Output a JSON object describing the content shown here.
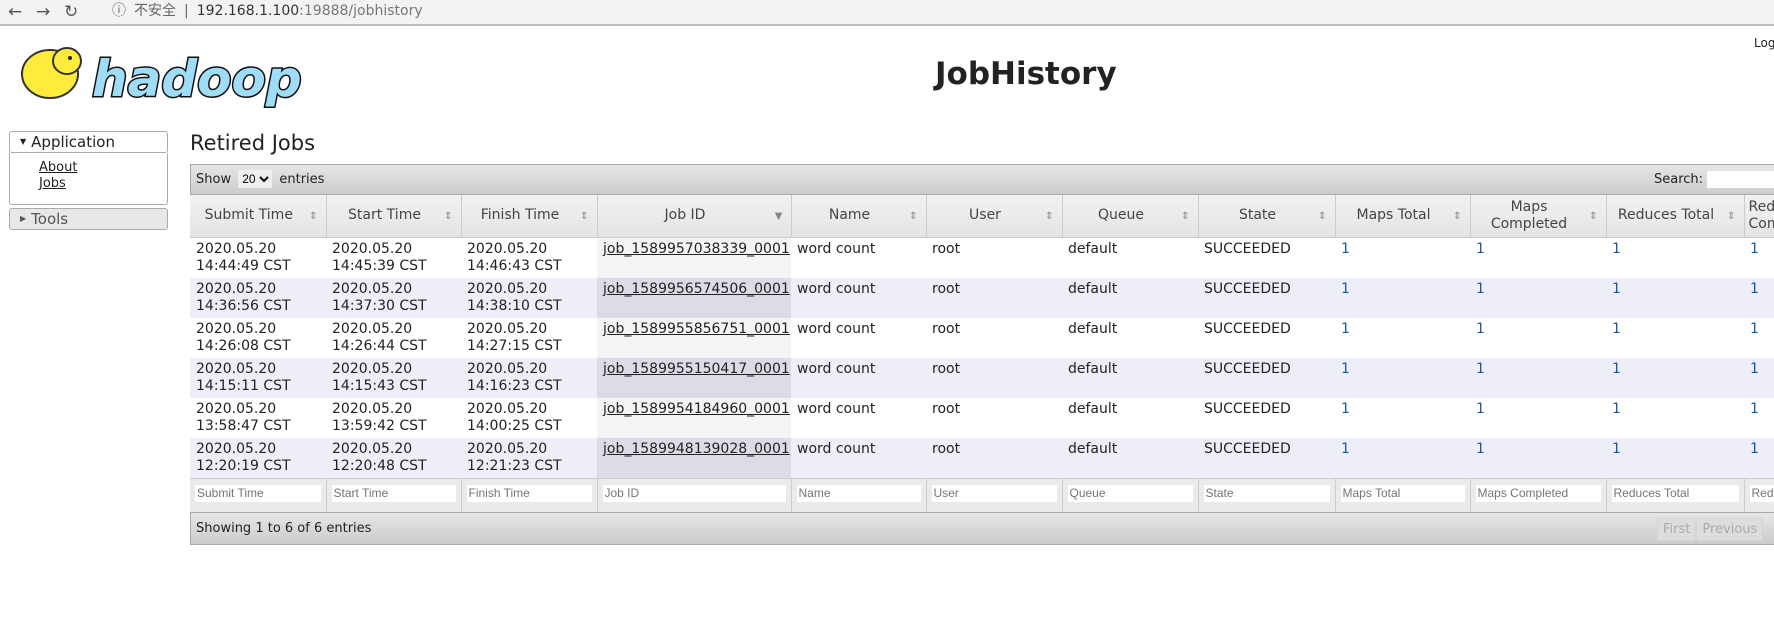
{
  "browser": {
    "url_host": "192.168.1.100",
    "url_rest": ":19888/jobhistory",
    "security_label": "不安全"
  },
  "header": {
    "logo_text": "hadoop",
    "title": "JobHistory",
    "login": "Log"
  },
  "sidebar": {
    "application": "Application",
    "links": [
      "About",
      "Jobs"
    ],
    "tools": "Tools"
  },
  "main": {
    "heading": "Retired Jobs",
    "show": "Show",
    "entries_value": "20",
    "entries": "entries",
    "search": "Search:",
    "columns": [
      "Submit Time",
      "Start Time",
      "Finish Time",
      "Job ID",
      "Name",
      "User",
      "Queue",
      "State",
      "Maps Total",
      "Maps Completed",
      "Reduces Total",
      "Reduces Completed"
    ],
    "filters": [
      "Submit Time",
      "Start Time",
      "Finish Time",
      "Job ID",
      "Name",
      "User",
      "Queue",
      "State",
      "Maps Total",
      "Maps Completed",
      "Reduces Total",
      "Reduces Completed"
    ],
    "rows": [
      {
        "submit": [
          "2020.05.20",
          "14:44:49 CST"
        ],
        "start": [
          "2020.05.20",
          "14:45:39 CST"
        ],
        "finish": [
          "2020.05.20",
          "14:46:43 CST"
        ],
        "job": "job_1589957038339_0001",
        "name": "word count",
        "user": "root",
        "queue": "default",
        "state": "SUCCEEDED",
        "maps_total": "1",
        "maps_completed": "1",
        "reduces_total": "1",
        "reduces_completed": "1"
      },
      {
        "submit": [
          "2020.05.20",
          "14:36:56 CST"
        ],
        "start": [
          "2020.05.20",
          "14:37:30 CST"
        ],
        "finish": [
          "2020.05.20",
          "14:38:10 CST"
        ],
        "job": "job_1589956574506_0001",
        "name": "word count",
        "user": "root",
        "queue": "default",
        "state": "SUCCEEDED",
        "maps_total": "1",
        "maps_completed": "1",
        "reduces_total": "1",
        "reduces_completed": "1"
      },
      {
        "submit": [
          "2020.05.20",
          "14:26:08 CST"
        ],
        "start": [
          "2020.05.20",
          "14:26:44 CST"
        ],
        "finish": [
          "2020.05.20",
          "14:27:15 CST"
        ],
        "job": "job_1589955856751_0001",
        "name": "word count",
        "user": "root",
        "queue": "default",
        "state": "SUCCEEDED",
        "maps_total": "1",
        "maps_completed": "1",
        "reduces_total": "1",
        "reduces_completed": "1"
      },
      {
        "submit": [
          "2020.05.20",
          "14:15:11 CST"
        ],
        "start": [
          "2020.05.20",
          "14:15:43 CST"
        ],
        "finish": [
          "2020.05.20",
          "14:16:23 CST"
        ],
        "job": "job_1589955150417_0001",
        "name": "word count",
        "user": "root",
        "queue": "default",
        "state": "SUCCEEDED",
        "maps_total": "1",
        "maps_completed": "1",
        "reduces_total": "1",
        "reduces_completed": "1"
      },
      {
        "submit": [
          "2020.05.20",
          "13:58:47 CST"
        ],
        "start": [
          "2020.05.20",
          "13:59:42 CST"
        ],
        "finish": [
          "2020.05.20",
          "14:00:25 CST"
        ],
        "job": "job_1589954184960_0001",
        "name": "word count",
        "user": "root",
        "queue": "default",
        "state": "SUCCEEDED",
        "maps_total": "1",
        "maps_completed": "1",
        "reduces_total": "1",
        "reduces_completed": "1"
      },
      {
        "submit": [
          "2020.05.20",
          "12:20:19 CST"
        ],
        "start": [
          "2020.05.20",
          "12:20:48 CST"
        ],
        "finish": [
          "2020.05.20",
          "12:21:23 CST"
        ],
        "job": "job_1589948139028_0001",
        "name": "word count",
        "user": "root",
        "queue": "default",
        "state": "SUCCEEDED",
        "maps_total": "1",
        "maps_completed": "1",
        "reduces_total": "1",
        "reduces_completed": "1"
      }
    ],
    "info": "Showing 1 to 6 of 6 entries",
    "pagination": [
      "First",
      "Previous"
    ]
  }
}
